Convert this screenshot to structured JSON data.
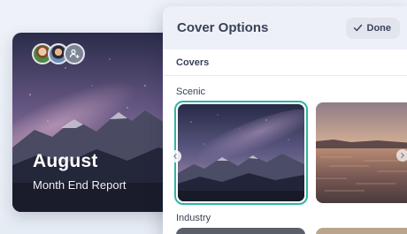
{
  "document": {
    "title": "August",
    "subtitle": "Month End Report"
  },
  "panel": {
    "title": "Cover Options",
    "done_label": "Done",
    "tab_label": "Covers",
    "sections": [
      "Scenic",
      "Industry"
    ]
  },
  "icons": {
    "done": "check-icon",
    "add_collaborator": "add-user-icon",
    "prev": "chevron-left-icon",
    "next": "chevron-right-icon"
  },
  "colors": {
    "selection_border": "#2fb5a3",
    "panel_header_bg": "#eef0f8",
    "text_primary": "#3a4257"
  }
}
